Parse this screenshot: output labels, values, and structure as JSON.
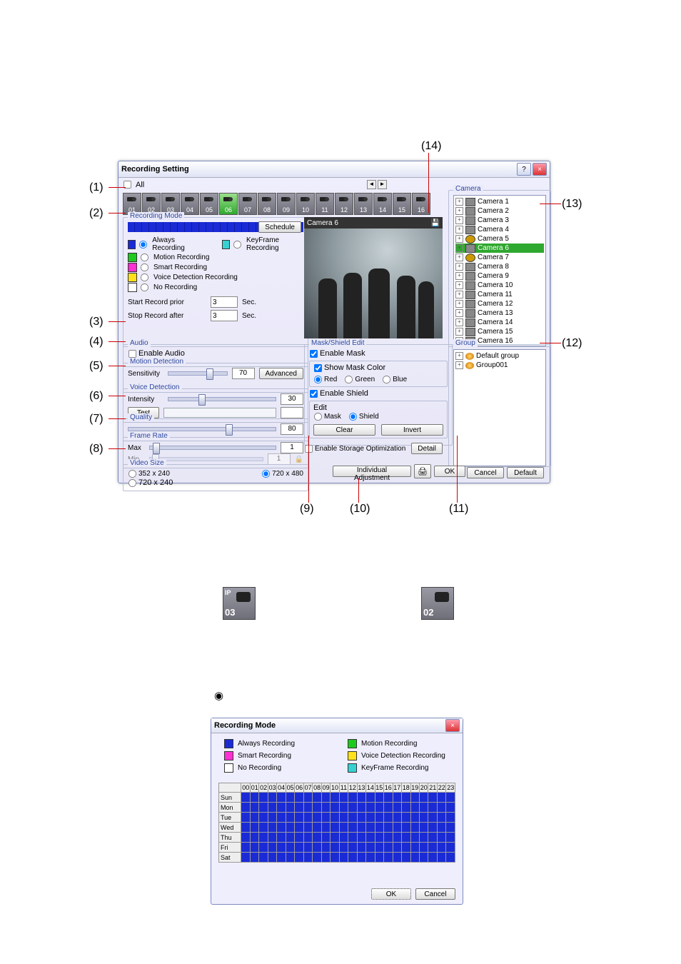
{
  "dialog1": {
    "title": "Recording Setting",
    "help_icon": "?",
    "close_icon": "×",
    "all_checkbox_label": "All",
    "nav_left": "◄",
    "nav_right": "►",
    "camera_tabs": [
      "01",
      "02",
      "03",
      "04",
      "05",
      "06",
      "07",
      "08",
      "09",
      "10",
      "11",
      "12",
      "13",
      "14",
      "15",
      "16"
    ],
    "selected_tab": "06"
  },
  "recmode": {
    "legend": "Recording Mode",
    "schedule_btn": "Schedule",
    "modes": [
      {
        "color": "#1a2bd6",
        "label": "Always Recording",
        "checked": true
      },
      {
        "color": "#37d1d1",
        "label": "KeyFrame Recording",
        "checked": false
      },
      {
        "color": "#1ec91e",
        "label": "Motion Recording",
        "checked": false
      },
      {
        "color": "#ff2fd6",
        "label": "Smart Recording",
        "checked": false
      },
      {
        "color": "#ffe21a",
        "label": "Voice Detection Recording",
        "checked": false
      },
      {
        "color": "#ffffff",
        "label": "No Recording",
        "checked": false
      }
    ],
    "prior_label": "Start Record prior",
    "prior_val": "3",
    "sec": "Sec.",
    "after_label": "Stop Record after",
    "after_val": "3"
  },
  "preview": {
    "title": "Camera 6",
    "save_icon": "💾"
  },
  "audio": {
    "legend": "Audio",
    "enable": "Enable Audio"
  },
  "motion": {
    "legend": "Motion Detection",
    "sens_label": "Sensitivity",
    "sens_val": "70",
    "adv_btn": "Advanced"
  },
  "voice": {
    "legend": "Voice Detection",
    "int_label": "Intensity",
    "int_val": "30",
    "test_btn": "Test"
  },
  "quality": {
    "legend": "Quality",
    "val": "80"
  },
  "frate": {
    "legend": "Frame Rate",
    "max_label": "Max",
    "max_val": "1",
    "min_label": "Min",
    "min_val": "1"
  },
  "vsize": {
    "legend": "Video Size",
    "o1": "352 x 240",
    "o2": "720 x 240",
    "o3": "720 x 480"
  },
  "mask": {
    "legend": "Mask/Shield Edit",
    "enable_mask": "Enable Mask",
    "show_mask": "Show Mask",
    "color_legend": "Color",
    "red": "Red",
    "green": "Green",
    "blue": "Blue",
    "enable_shield": "Enable Shield",
    "edit_legend": "Edit",
    "mask": "Mask",
    "shield": "Shield",
    "clear": "Clear",
    "invert": "Invert"
  },
  "storage": {
    "label": "Enable Storage Optimization",
    "detail": "Detail"
  },
  "camerabox": {
    "legend": "Camera",
    "items": [
      {
        "label": "Camera 1",
        "type": "cam"
      },
      {
        "label": "Camera 2",
        "type": "cam"
      },
      {
        "label": "Camera 3",
        "type": "cam"
      },
      {
        "label": "Camera 4",
        "type": "cam"
      },
      {
        "label": "Camera 5",
        "type": "ptz"
      },
      {
        "label": "Camera 6",
        "type": "cam",
        "selected": true
      },
      {
        "label": "Camera 7",
        "type": "ptz"
      },
      {
        "label": "Camera 8",
        "type": "cam"
      },
      {
        "label": "Camera 9",
        "type": "cam"
      },
      {
        "label": "Camera 10",
        "type": "cam"
      },
      {
        "label": "Camera 11",
        "type": "cam"
      },
      {
        "label": "Camera 12",
        "type": "cam"
      },
      {
        "label": "Camera 13",
        "type": "cam"
      },
      {
        "label": "Camera 14",
        "type": "cam"
      },
      {
        "label": "Camera 15",
        "type": "cam"
      },
      {
        "label": "Camera 16",
        "type": "cam"
      }
    ]
  },
  "groupbox": {
    "legend": "Group",
    "items": [
      {
        "label": "Default group"
      },
      {
        "label": "Group001"
      }
    ]
  },
  "buttons": {
    "indiv": "Individual Adjustment",
    "ok": "OK",
    "cancel": "Cancel",
    "default": "Default"
  },
  "callouts": {
    "1": "(1)",
    "2": "(2)",
    "3": "(3)",
    "4": "(4)",
    "5": "(5)",
    "6": "(6)",
    "7": "(7)",
    "8": "(8)",
    "9": "(9)",
    "10": "(10)",
    "11": "(11)",
    "12": "(12)",
    "13": "(13)",
    "14": "(14)"
  },
  "iconexamples": {
    "ip": "IP",
    "n03": "03",
    "n02": "02"
  },
  "radio_dot": "◉",
  "dialog2": {
    "title": "Recording Mode",
    "close": "×",
    "legend": [
      {
        "color": "#1a2bd6",
        "label": "Always Recording"
      },
      {
        "color": "#1ec91e",
        "label": "Motion Recording"
      },
      {
        "color": "#ff2fd6",
        "label": "Smart Recording"
      },
      {
        "color": "#ffe21a",
        "label": "Voice Detection Recording"
      },
      {
        "color": "#ffffff",
        "label": "No Recording"
      },
      {
        "color": "#37d1d1",
        "label": "KeyFrame Recording"
      }
    ],
    "hours": [
      "00",
      "01",
      "02",
      "03",
      "04",
      "05",
      "06",
      "07",
      "08",
      "09",
      "10",
      "11",
      "12",
      "13",
      "14",
      "15",
      "16",
      "17",
      "18",
      "19",
      "20",
      "21",
      "22",
      "23"
    ],
    "days": [
      "Sun",
      "Mon",
      "Tue",
      "Wed",
      "Thu",
      "Fri",
      "Sat"
    ],
    "ok": "OK",
    "cancel": "Cancel"
  }
}
